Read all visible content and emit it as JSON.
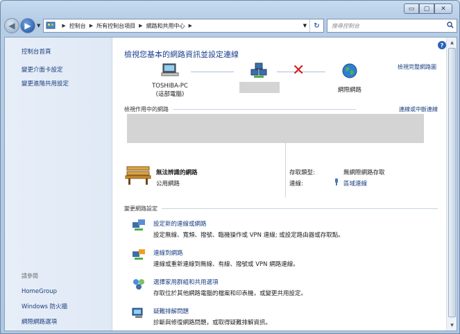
{
  "window": {
    "minimize": "▭",
    "maximize": "▢",
    "close": "✕"
  },
  "address": {
    "crumbs": [
      "控制台",
      "所有控制台項目",
      "網路和共用中心"
    ],
    "search_placeholder": "搜尋控制台"
  },
  "sidebar": {
    "home": "控制台首頁",
    "items": [
      "變更介面卡設定",
      "變更進階共用設定"
    ],
    "see_also": "請參閱",
    "see_also_items": [
      "HomeGroup",
      "Windows 防火牆",
      "網際網路選項"
    ]
  },
  "main": {
    "title": "檢視您基本的網路資訊並設定連線",
    "full_map": "檢視完整網路圖",
    "computer_name": "TOSHIBA-PC",
    "computer_sub": "(這部電腦)",
    "internet": "網際網路",
    "active_networks": "檢視作用中的網路",
    "connect_disconnect": "連線或中斷連線",
    "network_name": "無法辨識的網路",
    "network_type": "公用網路",
    "access_type_label": "存取類型:",
    "access_type_value": "無網際網路存取",
    "connections_label": "連線:",
    "connections_value": "區域連線",
    "change_settings": "變更網路設定",
    "tasks": [
      {
        "title": "設定新的連線或網路",
        "desc": "設定無線、寬頻、撥號、臨機操作或 VPN 連線; 或設定路由器或存取點。"
      },
      {
        "title": "連線到網路",
        "desc": "連線或重新連線到無線、有線、撥號或 VPN 網路連線。"
      },
      {
        "title": "選擇家用群組和共用選項",
        "desc": "存取位於其他網路電腦的檔案和印表機，或變更共用設定。"
      },
      {
        "title": "疑難排解問題",
        "desc": "診斷與修復網路問題，或取得疑難排解資訊。"
      }
    ]
  },
  "icons": {
    "back": "back-arrow-icon",
    "forward": "forward-arrow-icon",
    "search": "magnifier-icon",
    "refresh": "refresh-icon",
    "help": "help-icon"
  }
}
